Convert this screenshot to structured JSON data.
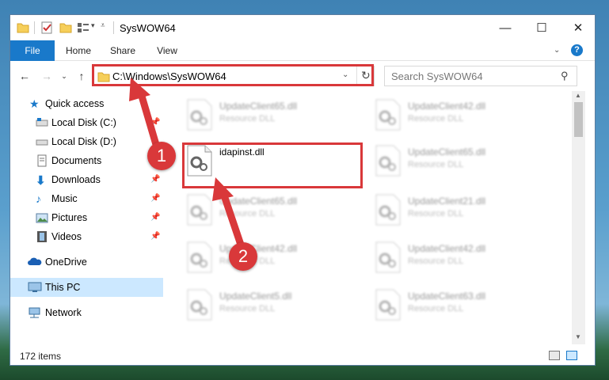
{
  "window": {
    "title": "SysWOW64"
  },
  "ribbon": {
    "tabs": [
      "File",
      "Home",
      "Share",
      "View"
    ]
  },
  "address": {
    "path": "C:\\Windows\\SysWOW64"
  },
  "search": {
    "placeholder": "Search SysWOW64"
  },
  "sidebar": {
    "items": [
      {
        "label": "Quick access",
        "icon": "star-icon"
      },
      {
        "label": "Local Disk (C:)",
        "icon": "drive-icon"
      },
      {
        "label": "Local Disk (D:)",
        "icon": "drive-icon"
      },
      {
        "label": "Documents",
        "icon": "documents-icon"
      },
      {
        "label": "Downloads",
        "icon": "download-icon"
      },
      {
        "label": "Music",
        "icon": "music-icon"
      },
      {
        "label": "Pictures",
        "icon": "pictures-icon"
      },
      {
        "label": "Videos",
        "icon": "videos-icon"
      },
      {
        "label": "OneDrive",
        "icon": "cloud-icon"
      },
      {
        "label": "This PC",
        "icon": "computer-icon"
      },
      {
        "label": "Network",
        "icon": "network-icon"
      }
    ]
  },
  "files": [
    {
      "name": "UpdateClient65.dll",
      "type": "Resource DLL"
    },
    {
      "name": "UpdateClient42.dll",
      "type": "Resource DLL"
    },
    {
      "name": "idapinst.dll",
      "type": ""
    },
    {
      "name": "UpdateClient65.dll",
      "type": "Resource DLL"
    },
    {
      "name": "UpdateClient65.dll",
      "type": "Resource DLL"
    },
    {
      "name": "UpdateClient21.dll",
      "type": "Resource DLL"
    },
    {
      "name": "UpdateClient42.dll",
      "type": "Resource DLL"
    },
    {
      "name": "UpdateClient42.dll",
      "type": "Resource DLL"
    },
    {
      "name": "UpdateClient5.dll",
      "type": "Resource DLL"
    },
    {
      "name": "UpdateClient63.dll",
      "type": "Resource DLL"
    }
  ],
  "status": {
    "items": "172 items"
  },
  "callouts": {
    "one": "1",
    "two": "2"
  },
  "colors": {
    "accent": "#1979ca",
    "highlight": "#d9383a"
  }
}
